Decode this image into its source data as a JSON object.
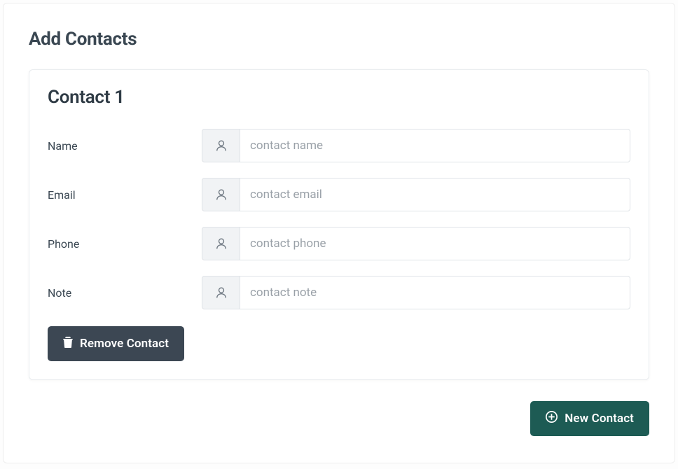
{
  "page": {
    "title": "Add Contacts"
  },
  "contact": {
    "heading": "Contact 1",
    "fields": {
      "name": {
        "label": "Name",
        "placeholder": "contact name",
        "value": ""
      },
      "email": {
        "label": "Email",
        "placeholder": "contact email",
        "value": ""
      },
      "phone": {
        "label": "Phone",
        "placeholder": "contact phone",
        "value": ""
      },
      "note": {
        "label": "Note",
        "placeholder": "contact note",
        "value": ""
      }
    },
    "remove_label": "Remove Contact"
  },
  "actions": {
    "new_contact_label": "New Contact"
  }
}
